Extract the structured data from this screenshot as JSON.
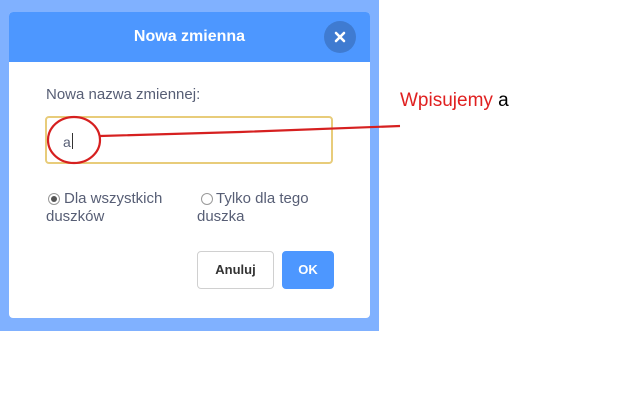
{
  "colors": {
    "accent": "#4d97ff",
    "backdrop": "#80b1ff",
    "annotation": "#e02020",
    "input_border": "#e8cc7a"
  },
  "dialog": {
    "title": "Nowa zmienna",
    "close_icon": "close-icon",
    "field_label": "Nowa nazwa zmiennej:",
    "input_value": "a",
    "scope_options": [
      {
        "line1": "Dla wszystkich",
        "line2": "duszków",
        "selected": true
      },
      {
        "line1": "Tylko dla tego",
        "line2": "duszka",
        "selected": false
      }
    ],
    "cancel_label": "Anuluj",
    "ok_label": "OK"
  },
  "annotation": {
    "highlight": "Wpisujemy",
    "text": " a"
  }
}
